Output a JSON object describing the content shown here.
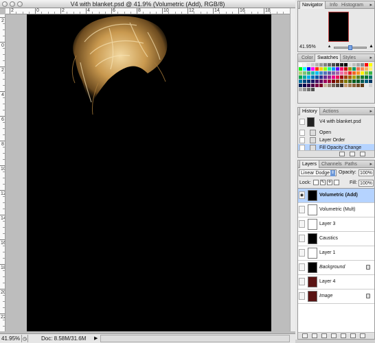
{
  "document": {
    "title": "V4 with blanket.psd @ 41.9% (Volumetric (Add), RGB/8)",
    "ruler_h_labels": [
      "2",
      "0",
      "2",
      "4",
      "6",
      "8",
      "10",
      "12",
      "14",
      "16",
      "18"
    ],
    "ruler_v_labels": [
      "2",
      "0",
      "2",
      "4",
      "6",
      "8",
      "10",
      "12",
      "14",
      "16",
      "18",
      "20",
      "22"
    ],
    "zoom": "41.95%",
    "doc_info": "Doc: 8.58M/31.6M"
  },
  "navigator": {
    "tabs": [
      "Navigator",
      "Info",
      "Histogram"
    ],
    "zoom": "41.95%"
  },
  "swatches": {
    "tabs": [
      "Color",
      "Swatches",
      "Styles"
    ],
    "colors": [
      "#ffffff",
      "#f2f2f2",
      "#e0e0e0",
      "#cccccc",
      "#b3b3b3",
      "#999999",
      "#808080",
      "#666666",
      "#4d4d4d",
      "#333333",
      "#1a1a1a",
      "#000000",
      "#d9d9d9",
      "#bfbfbf",
      "#a6a6a6",
      "#8c8c8c",
      "#ff0000",
      "#ffff00",
      "#00ff00",
      "#00ffff",
      "#0000ff",
      "#ff00ff",
      "#ff3300",
      "#ffcc00",
      "#99ff00",
      "#00ff99",
      "#0099ff",
      "#6600ff",
      "#ff0066",
      "#cc0000",
      "#999900",
      "#009966",
      "#f26c4f",
      "#f68e56",
      "#fbaf5d",
      "#fff467",
      "#acd372",
      "#7cc576",
      "#3bb878",
      "#1abbb4",
      "#00bff3",
      "#438ccb",
      "#5574b9",
      "#605ca8",
      "#855fa8",
      "#a763a8",
      "#f06ea9",
      "#f26d7d",
      "#ed1c24",
      "#f26522",
      "#f7941d",
      "#fff200",
      "#8dc63f",
      "#39b54a",
      "#00a651",
      "#00a99d",
      "#00aeef",
      "#0072bc",
      "#0054a6",
      "#2e3192",
      "#662d91",
      "#92278f",
      "#ec008c",
      "#ed145b",
      "#9e0b0f",
      "#a0410d",
      "#a36209",
      "#aba000",
      "#598527",
      "#1a7b30",
      "#007236",
      "#00746b",
      "#0076a3",
      "#004b80",
      "#003471",
      "#1b1464",
      "#440e62",
      "#630460",
      "#9e005d",
      "#9e0039",
      "#790000",
      "#7b2e00",
      "#7d4900",
      "#827b00",
      "#406618",
      "#005e20",
      "#005826",
      "#005952",
      "#005b7f",
      "#003663",
      "#002157",
      "#0d004c",
      "#32004b",
      "#4b0049",
      "#7b0046",
      "#7a0026",
      "#c7b299",
      "#998675",
      "#736357",
      "#534741",
      "#37302d",
      "#c69c6d",
      "#a67c52",
      "#8c6239",
      "#754c24",
      "#603913",
      "#e8e8e8",
      "#d0d0d0",
      "#b0b0b0",
      "#909090",
      "#707070",
      "#505050"
    ]
  },
  "history": {
    "tabs": [
      "History",
      "Actions"
    ],
    "snapshot": "V4 with blanket.psd",
    "items": [
      "Open",
      "Layer Order",
      "Fill Opacity Change"
    ]
  },
  "layers": {
    "tabs": [
      "Layers",
      "Channels",
      "Paths"
    ],
    "blend_mode": "Linear Dodge",
    "opacity_label": "Opacity:",
    "opacity": "100%",
    "lock_label": "Lock:",
    "fill_label": "Fill:",
    "fill": "100%",
    "items": [
      {
        "name": "Volumetric (Add)",
        "style": "bold",
        "thumb": "#000000",
        "locked": false
      },
      {
        "name": "Volumetric (Mult)",
        "style": "normal",
        "thumb": "#ffffff",
        "locked": false
      },
      {
        "name": "Layer 3",
        "style": "normal",
        "thumb": "#ffffff",
        "locked": false
      },
      {
        "name": "Caustics",
        "style": "normal",
        "thumb": "#000000",
        "locked": false
      },
      {
        "name": "Layer 1",
        "style": "normal",
        "thumb": "#ffffff",
        "locked": false
      },
      {
        "name": "Background",
        "style": "italic",
        "thumb": "#000000",
        "locked": true
      },
      {
        "name": "Layer 4",
        "style": "normal",
        "thumb": "#5a1414",
        "locked": false
      },
      {
        "name": "Image",
        "style": "italic",
        "thumb": "#5a1414",
        "locked": true
      }
    ]
  }
}
